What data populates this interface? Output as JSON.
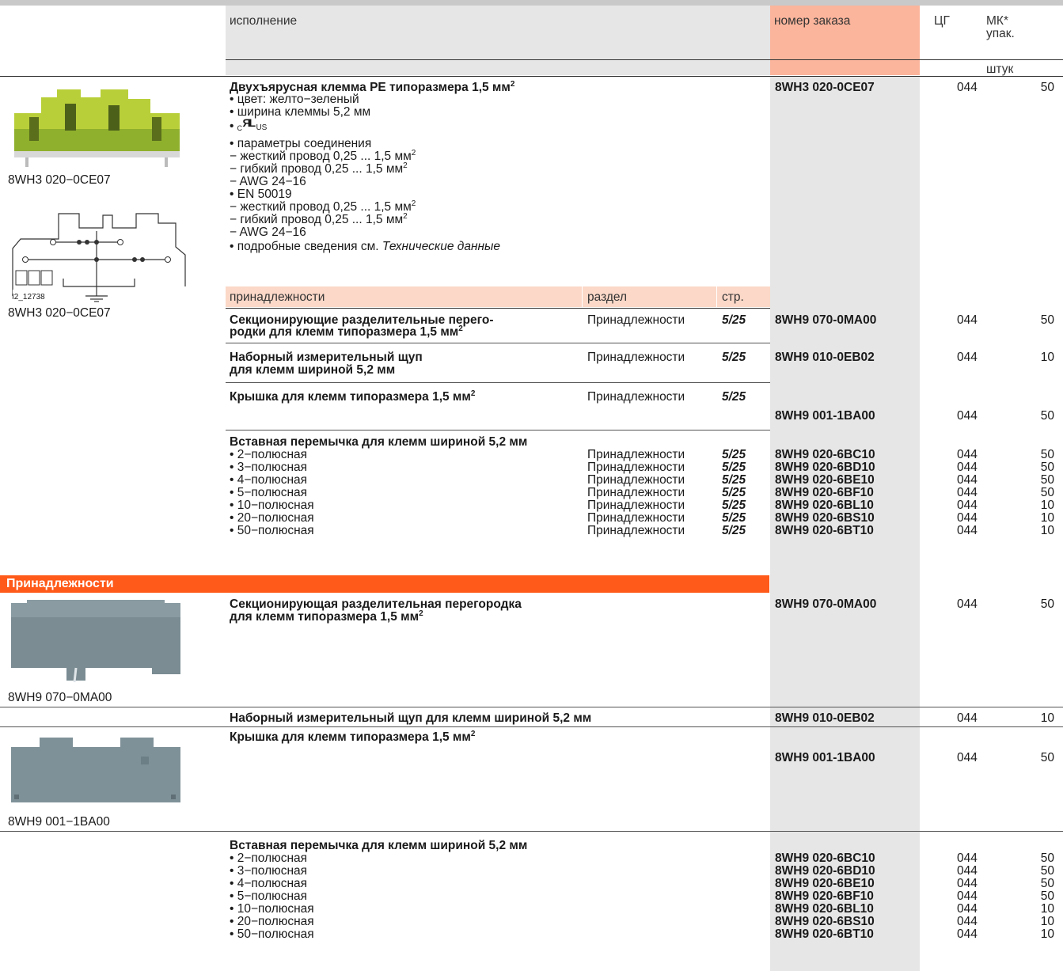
{
  "header": {
    "col_exec": "исполнение",
    "col_order": "номер заказа",
    "col_price_group": "ЦГ",
    "col_mk": "МК*",
    "col_pack": "упак.",
    "col_unit": "штук"
  },
  "product": {
    "image_caption": "8WH3 020−0CE07",
    "diagram_label": "I2_12738",
    "diagram_caption": "8WH3 020−0CE07",
    "title": "Двухъярусная клемма PE типоразмера 1,5 мм",
    "title_sup": "2",
    "lines": [
      "• цвет: желто−зеленый",
      "• ширина клеммы 5,2 мм",
      "•",
      "• параметры соединения",
      " − жесткий провод 0,25 ... 1,5 мм",
      " − гибкий провод 0,25 ... 1,5 мм",
      " − AWG 24−16",
      "• EN 50019",
      " − жесткий провод 0,25 ... 1,5 мм",
      " − гибкий провод 0,25 ... 1,5 мм",
      " − AWG 24−16",
      "• подробные сведения см. "
    ],
    "ul_mark": "cULus",
    "ul_c": "C",
    "ul_us": "US",
    "tech_data": "Технические данные",
    "order": "8WH3 020-0CE07",
    "pg": "044",
    "qty": "50"
  },
  "acc_header": {
    "label": "принадлежности",
    "section": "раздел",
    "page": "стр."
  },
  "accessories": [
    {
      "name1": "Секционирующие разделительные перего-",
      "name2": "родки для клемм типоразмера 1,5 мм",
      "section": "Принадлежности",
      "page": "5/25",
      "order": "8WH9 070-0MA00",
      "pg": "044",
      "qty": "50"
    },
    {
      "name1": "Наборный измерительный щуп",
      "name2": "для клемм шириной 5,2 мм",
      "section": "Принадлежности",
      "page": "5/25",
      "order": "8WH9 010-0EB02",
      "pg": "044",
      "qty": "10"
    },
    {
      "name1": "Крышка для клемм типоразмера 1,5 мм",
      "section": "Принадлежности",
      "page": "5/25",
      "order": "8WH9 001-1BA00",
      "pg": "044",
      "qty": "50"
    }
  ],
  "jumper_title": "Вставная перемычка для клемм шириной 5,2 мм",
  "jumpers": [
    {
      "label": "• 2−полюсная",
      "section": "Принадлежности",
      "page": "5/25",
      "order": "8WH9 020-6BC10",
      "pg": "044",
      "qty": "50"
    },
    {
      "label": "• 3−полюсная",
      "section": "Принадлежности",
      "page": "5/25",
      "order": "8WH9 020-6BD10",
      "pg": "044",
      "qty": "50"
    },
    {
      "label": "• 4−полюсная",
      "section": "Принадлежности",
      "page": "5/25",
      "order": "8WH9 020-6BE10",
      "pg": "044",
      "qty": "50"
    },
    {
      "label": "• 5−полюсная",
      "section": "Принадлежности",
      "page": "5/25",
      "order": "8WH9 020-6BF10",
      "pg": "044",
      "qty": "50"
    },
    {
      "label": "• 10−полюсная",
      "section": "Принадлежности",
      "page": "5/25",
      "order": "8WH9 020-6BL10",
      "pg": "044",
      "qty": "10"
    },
    {
      "label": "• 20−полюсная",
      "section": "Принадлежности",
      "page": "5/25",
      "order": "8WH9 020-6BS10",
      "pg": "044",
      "qty": "10"
    },
    {
      "label": "• 50−полюсная",
      "section": "Принадлежности",
      "page": "5/25",
      "order": "8WH9 020-6BT10",
      "pg": "044",
      "qty": "10"
    }
  ],
  "section2": {
    "title": "Принадлежности",
    "item1": {
      "name1": "Секционирующая разделительная перегородка",
      "name2": "для клемм типоразмера 1,5 мм",
      "caption": "8WH9 070−0MA00",
      "order": "8WH9 070-0MA00",
      "pg": "044",
      "qty": "50"
    },
    "item2": {
      "name": "Наборный измерительный щуп для клемм шириной 5,2 мм",
      "order": "8WH9 010-0EB02",
      "pg": "044",
      "qty": "10"
    },
    "item3": {
      "name": "Крышка для клемм типоразмера 1,5 мм",
      "caption": "8WH9 001−1BA00",
      "order": "8WH9 001-1BA00",
      "pg": "044",
      "qty": "50"
    },
    "jumper_title": "Вставная перемычка для клемм шириной 5,2 мм",
    "jumpers": [
      {
        "label": "• 2−полюсная",
        "order": "8WH9 020-6BC10",
        "pg": "044",
        "qty": "50"
      },
      {
        "label": "• 3−полюсная",
        "order": "8WH9 020-6BD10",
        "pg": "044",
        "qty": "50"
      },
      {
        "label": "• 4−полюсная",
        "order": "8WH9 020-6BE10",
        "pg": "044",
        "qty": "50"
      },
      {
        "label": "• 5−полюсная",
        "order": "8WH9 020-6BF10",
        "pg": "044",
        "qty": "50"
      },
      {
        "label": "• 10−полюсная",
        "order": "8WH9 020-6BL10",
        "pg": "044",
        "qty": "10"
      },
      {
        "label": "• 20−полюсная",
        "order": "8WH9 020-6BS10",
        "pg": "044",
        "qty": "10"
      },
      {
        "label": "• 50−полюсная",
        "order": "8WH9 020-6BT10",
        "pg": "044",
        "qty": "10"
      }
    ]
  },
  "colors": {
    "accent_orange": "#ff5a19",
    "header_salmon": "#fbb59c",
    "order_col_gray": "#e6e6e6",
    "acc_header_peach": "#fbd8c8"
  }
}
